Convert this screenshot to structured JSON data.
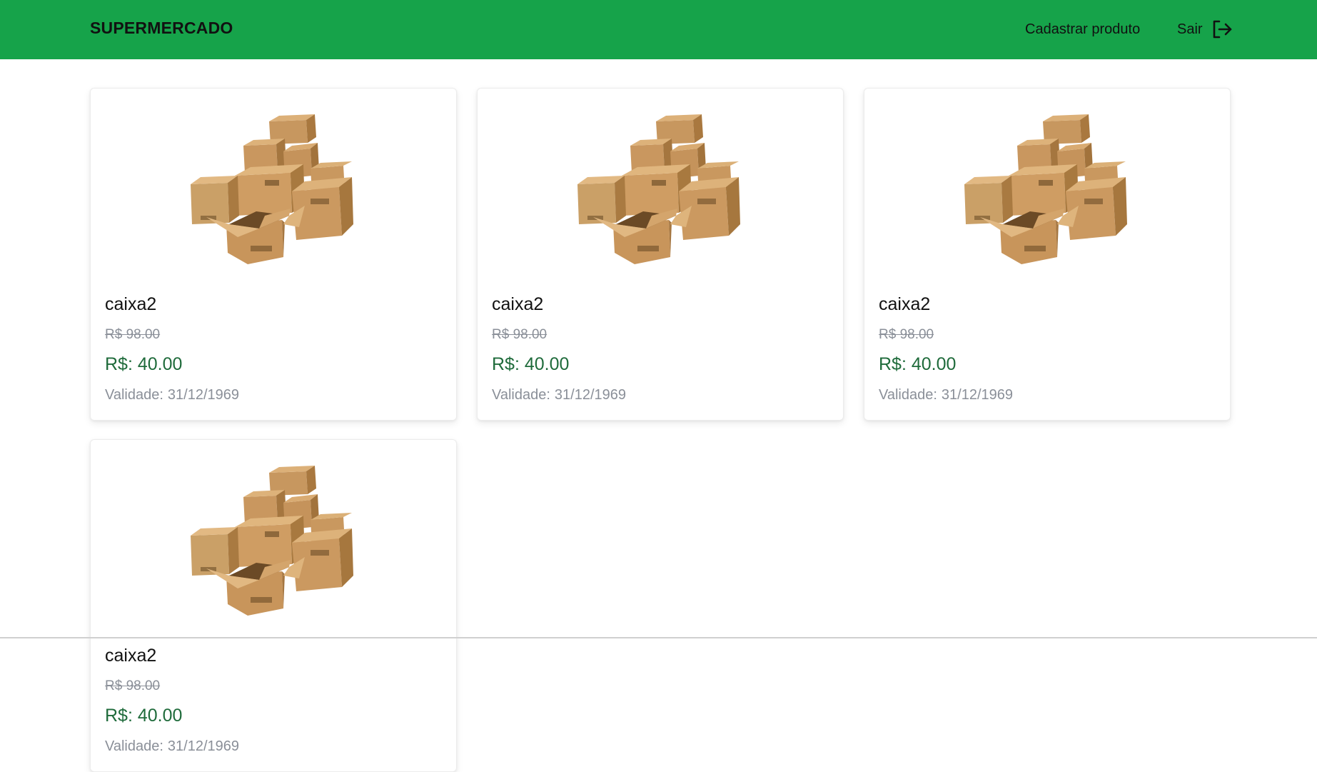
{
  "header": {
    "brand": "SUPERMERCADO",
    "register_link": "Cadastrar produto",
    "logout_link": "Sair",
    "bg_color": "#16a34a"
  },
  "products": [
    {
      "name": "caixa2",
      "old_price": "R$ 98.00",
      "price": "R$: 40.00",
      "validity_label": "Validade:",
      "validity": "31/12/1969",
      "image": "cardboard-boxes-image"
    },
    {
      "name": "caixa2",
      "old_price": "R$ 98.00",
      "price": "R$: 40.00",
      "validity_label": "Validade:",
      "validity": "31/12/1969",
      "image": "cardboard-boxes-image"
    },
    {
      "name": "caixa2",
      "old_price": "R$ 98.00",
      "price": "R$: 40.00",
      "validity_label": "Validade:",
      "validity": "31/12/1969",
      "image": "cardboard-boxes-image"
    },
    {
      "name": "caixa2",
      "old_price": "R$ 98.00",
      "price": "R$: 40.00",
      "validity_label": "Validade:",
      "validity": "31/12/1969",
      "image": "cardboard-boxes-image"
    }
  ],
  "colors": {
    "price": "#1f6b3b",
    "muted": "#8a8f98",
    "box": "#c9955a"
  }
}
